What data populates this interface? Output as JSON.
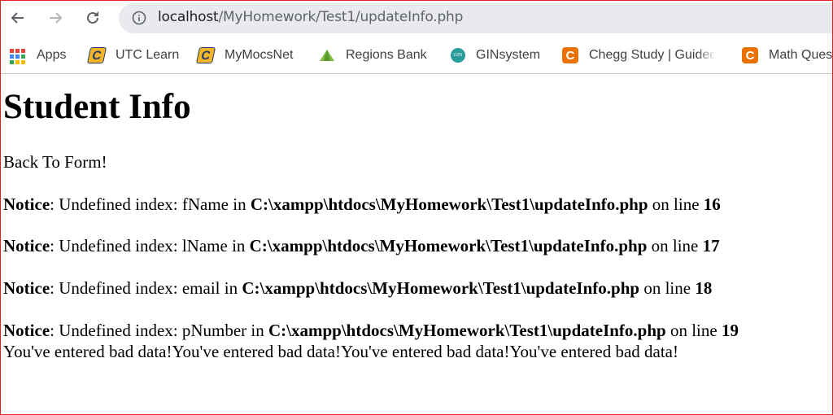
{
  "browser": {
    "url_host": "localhost",
    "url_path": "/MyHomework/Test1/updateInfo.php",
    "bookmarks": [
      {
        "label": "Apps",
        "icon": "apps-grid-icon"
      },
      {
        "label": "UTC Learn",
        "icon": "utc-c-icon"
      },
      {
        "label": "MyMocsNet",
        "icon": "utc-c-icon"
      },
      {
        "label": "Regions Bank",
        "icon": "regions-triangle-icon"
      },
      {
        "label": "GINsystem",
        "icon": "gin-icon",
        "icon_text": "GIN"
      },
      {
        "label": "Chegg Study | Guidec",
        "icon": "chegg-c-icon",
        "icon_text": "C"
      },
      {
        "label": "Math Ques",
        "icon": "chegg-c-icon",
        "icon_text": "C"
      }
    ],
    "utc_icon_text": "C"
  },
  "page": {
    "title": "Student Info",
    "back_link": "Back To Form!",
    "notices": [
      {
        "label": "Notice",
        "message": ": Undefined index: fName in ",
        "path": "C:\\xampp\\htdocs\\MyHomework\\Test1\\updateInfo.php",
        "on_line": " on line ",
        "line": "16"
      },
      {
        "label": "Notice",
        "message": ": Undefined index: lName in ",
        "path": "C:\\xampp\\htdocs\\MyHomework\\Test1\\updateInfo.php",
        "on_line": " on line ",
        "line": "17"
      },
      {
        "label": "Notice",
        "message": ": Undefined index: email in ",
        "path": "C:\\xampp\\htdocs\\MyHomework\\Test1\\updateInfo.php",
        "on_line": " on line ",
        "line": "18"
      },
      {
        "label": "Notice",
        "message": ": Undefined index: pNumber in ",
        "path": "C:\\xampp\\htdocs\\MyHomework\\Test1\\updateInfo.php",
        "on_line": " on line ",
        "line": "19"
      }
    ],
    "bad_data": "You've entered bad data!You've entered bad data!You've entered bad data!You've entered bad data!"
  }
}
